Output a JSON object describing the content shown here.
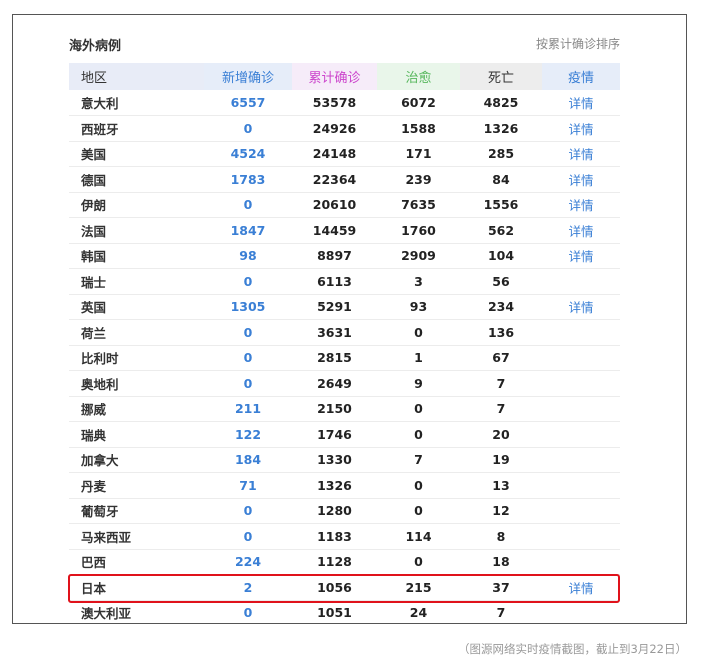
{
  "panel": {
    "title": "海外病例",
    "sort_label": "按累计确诊排序"
  },
  "table": {
    "headers": {
      "region": "地区",
      "new_confirmed": "新增确诊",
      "total_confirmed": "累计确诊",
      "cured": "治愈",
      "deaths": "死亡",
      "detail": "疫情"
    },
    "rows": [
      {
        "region": "意大利",
        "new": "6557",
        "total": "53578",
        "cured": "6072",
        "deaths": "4825",
        "detail": "详情"
      },
      {
        "region": "西班牙",
        "new": "0",
        "total": "24926",
        "cured": "1588",
        "deaths": "1326",
        "detail": "详情"
      },
      {
        "region": "美国",
        "new": "4524",
        "total": "24148",
        "cured": "171",
        "deaths": "285",
        "detail": "详情"
      },
      {
        "region": "德国",
        "new": "1783",
        "total": "22364",
        "cured": "239",
        "deaths": "84",
        "detail": "详情"
      },
      {
        "region": "伊朗",
        "new": "0",
        "total": "20610",
        "cured": "7635",
        "deaths": "1556",
        "detail": "详情"
      },
      {
        "region": "法国",
        "new": "1847",
        "total": "14459",
        "cured": "1760",
        "deaths": "562",
        "detail": "详情"
      },
      {
        "region": "韩国",
        "new": "98",
        "total": "8897",
        "cured": "2909",
        "deaths": "104",
        "detail": "详情"
      },
      {
        "region": "瑞士",
        "new": "0",
        "total": "6113",
        "cured": "3",
        "deaths": "56",
        "detail": ""
      },
      {
        "region": "英国",
        "new": "1305",
        "total": "5291",
        "cured": "93",
        "deaths": "234",
        "detail": "详情"
      },
      {
        "region": "荷兰",
        "new": "0",
        "total": "3631",
        "cured": "0",
        "deaths": "136",
        "detail": ""
      },
      {
        "region": "比利时",
        "new": "0",
        "total": "2815",
        "cured": "1",
        "deaths": "67",
        "detail": ""
      },
      {
        "region": "奥地利",
        "new": "0",
        "total": "2649",
        "cured": "9",
        "deaths": "7",
        "detail": ""
      },
      {
        "region": "挪威",
        "new": "211",
        "total": "2150",
        "cured": "0",
        "deaths": "7",
        "detail": ""
      },
      {
        "region": "瑞典",
        "new": "122",
        "total": "1746",
        "cured": "0",
        "deaths": "20",
        "detail": ""
      },
      {
        "region": "加拿大",
        "new": "184",
        "total": "1330",
        "cured": "7",
        "deaths": "19",
        "detail": ""
      },
      {
        "region": "丹麦",
        "new": "71",
        "total": "1326",
        "cured": "0",
        "deaths": "13",
        "detail": ""
      },
      {
        "region": "葡萄牙",
        "new": "0",
        "total": "1280",
        "cured": "0",
        "deaths": "12",
        "detail": ""
      },
      {
        "region": "马来西亚",
        "new": "0",
        "total": "1183",
        "cured": "114",
        "deaths": "8",
        "detail": ""
      },
      {
        "region": "巴西",
        "new": "224",
        "total": "1128",
        "cured": "0",
        "deaths": "18",
        "detail": ""
      },
      {
        "region": "日本",
        "new": "2",
        "total": "1056",
        "cured": "215",
        "deaths": "37",
        "detail": "详情"
      },
      {
        "region": "澳大利亚",
        "new": "0",
        "total": "1051",
        "cured": "24",
        "deaths": "7",
        "detail": ""
      }
    ]
  },
  "caption": "（图源网络实时疫情截图，截止到3月22日）",
  "colors": {
    "highlight_border": "#e0121b",
    "new_confirmed_text": "#3a7fd5",
    "total_confirmed_header": "#cc44cc",
    "cured_header": "#58b85e"
  }
}
